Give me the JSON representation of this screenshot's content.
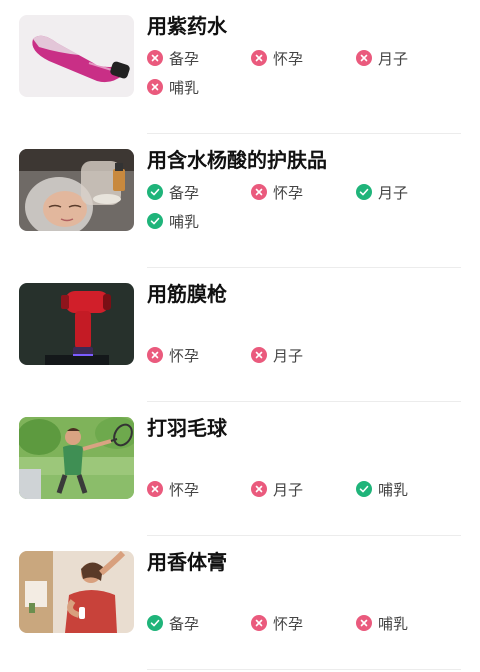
{
  "items": [
    {
      "title": "用紫药水",
      "thumb_icon": "purple-vial-photo",
      "tags": [
        {
          "label": "备孕",
          "status": "no"
        },
        {
          "label": "怀孕",
          "status": "no"
        },
        {
          "label": "月子",
          "status": "no"
        },
        {
          "label": "哺乳",
          "status": "no"
        }
      ]
    },
    {
      "title": "用含水杨酸的护肤品",
      "thumb_icon": "skincare-facial-photo",
      "tags": [
        {
          "label": "备孕",
          "status": "ok"
        },
        {
          "label": "怀孕",
          "status": "no"
        },
        {
          "label": "月子",
          "status": "ok"
        },
        {
          "label": "哺乳",
          "status": "ok"
        }
      ]
    },
    {
      "title": "用筋膜枪",
      "thumb_icon": "massage-gun-photo",
      "tags": [
        {
          "label": "怀孕",
          "status": "no"
        },
        {
          "label": "月子",
          "status": "no"
        }
      ]
    },
    {
      "title": "打羽毛球",
      "thumb_icon": "badminton-photo",
      "tags": [
        {
          "label": "怀孕",
          "status": "no"
        },
        {
          "label": "月子",
          "status": "no"
        },
        {
          "label": "哺乳",
          "status": "ok"
        }
      ]
    },
    {
      "title": "用香体膏",
      "thumb_icon": "deodorant-photo",
      "tags": [
        {
          "label": "备孕",
          "status": "ok"
        },
        {
          "label": "怀孕",
          "status": "no"
        },
        {
          "label": "哺乳",
          "status": "no"
        }
      ]
    }
  ],
  "colors": {
    "forbidden": "#ea5a7d",
    "allowed": "#1fb47a",
    "title": "#111111",
    "tag_text": "#444444"
  }
}
